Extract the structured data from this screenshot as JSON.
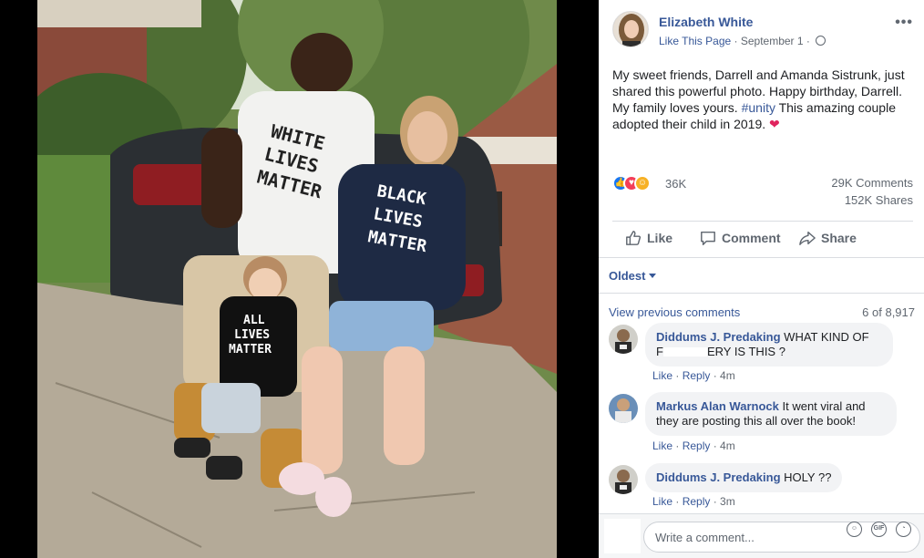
{
  "post": {
    "author": "Elizabeth White",
    "like_page": "Like This Page",
    "separator": " · ",
    "date": "September 1",
    "separator2": " · ",
    "more_icon": "more-options-icon",
    "text_part1": "My sweet friends, Darrell and Amanda Sistrunk, just shared this powerful photo. Happy birthday, Darrell. My family loves yours. ",
    "hashtag": "#unity",
    "text_part2": " This amazing couple adopted their child in 2019. ",
    "heart": "❤"
  },
  "stats": {
    "reactions": "36K",
    "comments": "29K Comments",
    "shares": "152K Shares"
  },
  "actions": {
    "like": "Like",
    "comment": "Comment",
    "share": "Share"
  },
  "comments_section": {
    "sort": "Oldest",
    "view_previous": "View previous comments",
    "count": "6 of 8,917",
    "items": [
      {
        "name": "Diddums J. Predaking",
        "text_a": "WHAT KIND OF",
        "text_b": "F",
        "text_c": "ERY IS THIS ?",
        "like": "Like",
        "reply": "Reply",
        "time": "4m"
      },
      {
        "name": "Markus Alan Warnock",
        "text_a": "It went viral and",
        "text_b": "they are posting this all over the book!",
        "like": "Like",
        "reply": "Reply",
        "time": "4m"
      },
      {
        "name": "Diddums J. Predaking",
        "text_a": "HOLY ??",
        "like": "Like",
        "reply": "Reply",
        "time": "3m"
      }
    ]
  },
  "photo": {
    "shirt_man": [
      "WHITE",
      "LIVES",
      "MATTER"
    ],
    "shirt_woman": [
      "BLACK",
      "LIVES",
      "MATTER"
    ],
    "shirt_child": [
      "ALL",
      "LIVES",
      "MATTER"
    ]
  },
  "composer": {
    "placeholder": "Write a comment...",
    "gif": "GIF"
  },
  "colors": {
    "link": "#385898",
    "muted": "#606770",
    "bubble": "#f2f3f5",
    "like_blue": "#1877f2",
    "love_red": "#f33e58"
  }
}
